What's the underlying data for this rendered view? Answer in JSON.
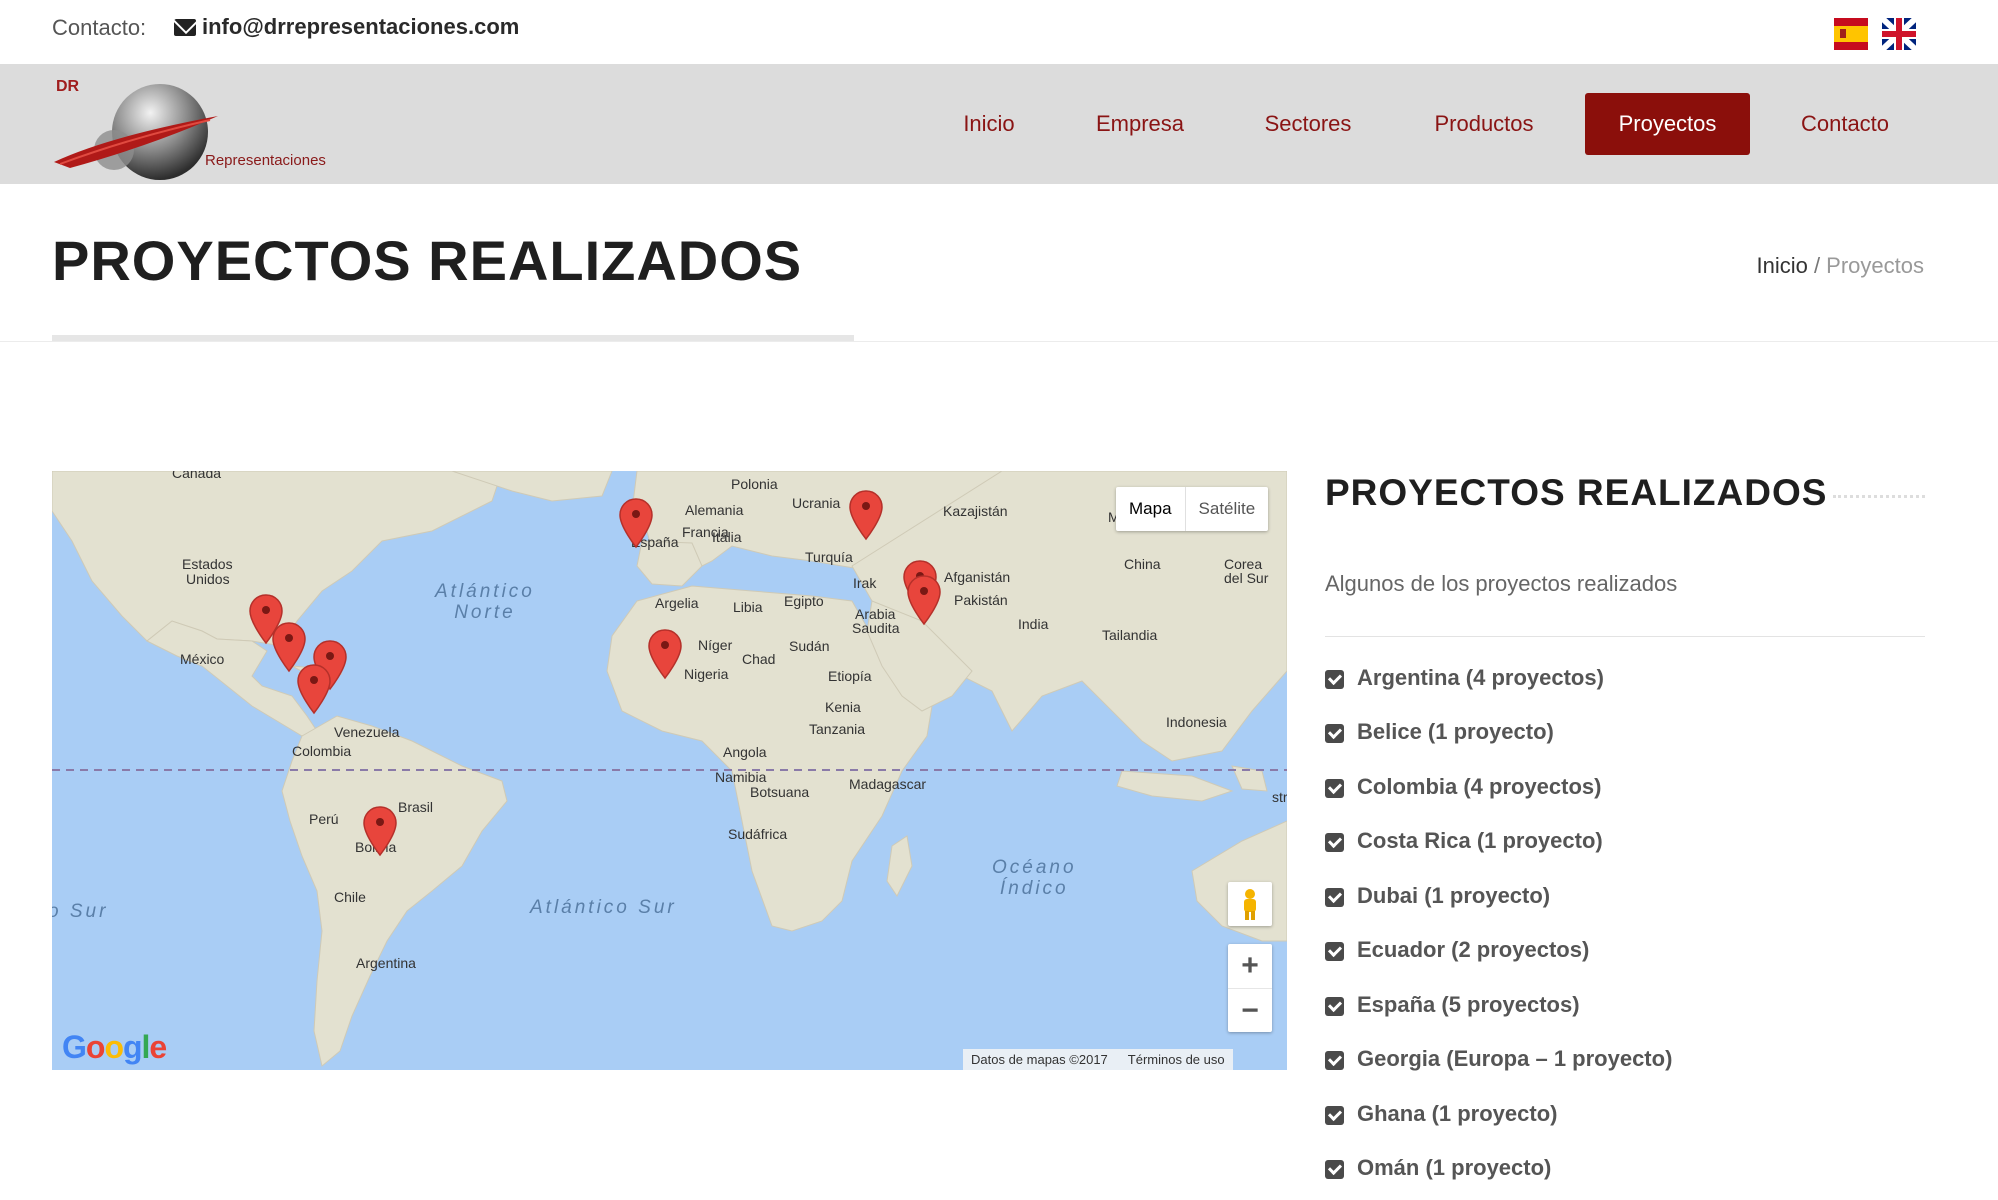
{
  "topbar": {
    "contact_label": "Contacto:",
    "email": "info@drrepresentaciones.com"
  },
  "logo": {
    "short": "DR",
    "name": "Representaciones"
  },
  "nav": {
    "items": [
      {
        "label": "Inicio"
      },
      {
        "label": "Empresa"
      },
      {
        "label": "Sectores"
      },
      {
        "label": "Productos"
      },
      {
        "label": "Proyectos",
        "active": true
      },
      {
        "label": "Contacto"
      }
    ]
  },
  "page": {
    "title": "PROYECTOS REALIZADOS"
  },
  "breadcrumb": {
    "home": "Inicio",
    "separator": " / ",
    "current": "Proyectos"
  },
  "map": {
    "toggle_map": "Mapa",
    "toggle_satellite": "Satélite",
    "zoom_in": "+",
    "zoom_out": "−",
    "google": "Google",
    "data_credit": "Datos de mapas ©2017",
    "terms": "Términos de uso",
    "labels": {
      "canada": "Canadá",
      "usa_1": "Estados",
      "usa_2": "Unidos",
      "mexico": "México",
      "venezuela": "Venezuela",
      "colombia": "Colombia",
      "brasil": "Brasil",
      "peru": "Perú",
      "bolivia": "Bolivia",
      "chile": "Chile",
      "argentina": "Argentina",
      "polonia": "Polonia",
      "alemania": "Alemania",
      "francia": "Francia",
      "espana": "España",
      "italia": "Italia",
      "ucrania": "Ucrania",
      "kazajistan": "Kazajistán",
      "turquia": "Turquía",
      "irak": "Irak",
      "afganistan": "Afganistán",
      "pakistan": "Pakistán",
      "arabia_1": "Arabia",
      "arabia_2": "Saudita",
      "china": "China",
      "corea_1": "Corea",
      "corea_2": "del Sur",
      "india": "India",
      "tailandia": "Tailandia",
      "indonesia": "Indonesia",
      "argelia": "Argelia",
      "libia": "Libia",
      "egipto": "Egipto",
      "niger": "Níger",
      "chad": "Chad",
      "sudan": "Sudán",
      "nigeria": "Nigeria",
      "etiopia": "Etiopía",
      "kenia": "Kenia",
      "tanzania": "Tanzania",
      "angola": "Angola",
      "namibia": "Namibia",
      "botsuana": "Botsuana",
      "madagascar": "Madagascar",
      "sudafrica": "Sudáfrica",
      "m_trunc": "M",
      "str_trunc": "str",
      "atlantico_norte_1": "Atlántico",
      "atlantico_norte_2": "Norte",
      "atlantico_sur": "Atlántico Sur",
      "oceano_indico_1": "Océano",
      "oceano_indico_2": "Índico",
      "pacifico_sur": "o Sur"
    }
  },
  "sidebar": {
    "title": "PROYECTOS REALIZADOS",
    "subtitle": "Algunos de los proyectos realizados",
    "items": [
      {
        "label": "Argentina (4 proyectos)"
      },
      {
        "label": "Belice (1 proyecto)"
      },
      {
        "label": "Colombia (4 proyectos)"
      },
      {
        "label": "Costa Rica (1 proyecto)"
      },
      {
        "label": "Dubai (1 proyecto)"
      },
      {
        "label": "Ecuador (2 proyectos)"
      },
      {
        "label": "España (5 proyectos)"
      },
      {
        "label": "Georgia (Europa – 1 proyecto)"
      },
      {
        "label": "Ghana (1 proyecto)"
      },
      {
        "label": "Omán (1 proyecto)"
      }
    ]
  },
  "colors": {
    "brand": "#8b0f0b",
    "nav_text": "#8a1414",
    "header_bg": "#dcdcdc",
    "ocean": "#a9cdf5",
    "land": "#e5e3d4",
    "marker": "#e8453c"
  }
}
